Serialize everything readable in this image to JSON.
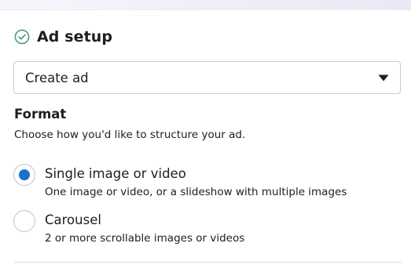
{
  "section": {
    "title": "Ad setup",
    "status_icon": "check-circle-icon",
    "status_color": "#4a9d7c"
  },
  "ad_select": {
    "value": "Create ad",
    "icon": "caret-down-icon"
  },
  "format": {
    "title": "Format",
    "description": "Choose how you'd like to structure your ad.",
    "options": [
      {
        "label": "Single image or video",
        "description": "One image or video, or a slideshow with multiple images",
        "selected": true
      },
      {
        "label": "Carousel",
        "description": "2 or more scrollable images or videos",
        "selected": false
      }
    ],
    "accent_color": "#1a73c9"
  }
}
